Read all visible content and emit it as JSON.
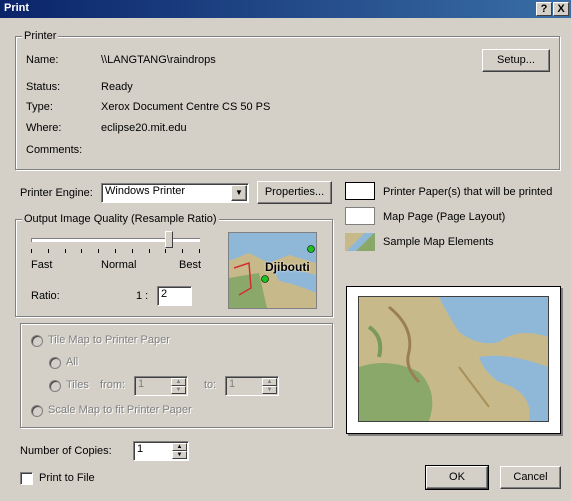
{
  "window": {
    "title": "Print",
    "help_label": "?",
    "close_label": "X"
  },
  "printer": {
    "group_label": "Printer",
    "name_label": "Name:",
    "name_value": "\\\\LANGTANG\\raindrops",
    "status_label": "Status:",
    "status_value": "Ready",
    "type_label": "Type:",
    "type_value": "Xerox Document Centre CS 50 PS",
    "where_label": "Where:",
    "where_value": "eclipse20.mit.edu",
    "comments_label": "Comments:",
    "comments_value": "",
    "setup_button": "Setup..."
  },
  "engine": {
    "label": "Printer Engine:",
    "value": "Windows Printer",
    "properties_button": "Properties..."
  },
  "legend_items": {
    "printer_paper": "Printer Paper(s) that will be printed",
    "map_page": "Map Page (Page Layout)",
    "sample_elements": "Sample Map Elements"
  },
  "quality": {
    "group_label": "Output Image Quality (Resample Ratio)",
    "slider_fraction": 0.82,
    "fast_label": "Fast",
    "normal_label": "Normal",
    "best_label": "Best",
    "ratio_label": "Ratio:",
    "ratio_prefix": "1 :",
    "ratio_value": "2",
    "preview_label": "Djibouti"
  },
  "tiling": {
    "tile_label": "Tile Map to Printer Paper",
    "all_label": "All",
    "tiles_label": "Tiles",
    "from_label": "from:",
    "from_value": "1",
    "to_label": "to:",
    "to_value": "1",
    "scale_label": "Scale Map to fit Printer Paper"
  },
  "copies": {
    "label": "Number of Copies:",
    "value": "1"
  },
  "print_to_file": {
    "label": "Print to File",
    "checked": false
  },
  "buttons": {
    "ok": "OK",
    "cancel": "Cancel"
  },
  "colors": {
    "title_start": "#0a246a",
    "title_end": "#3a6ea5",
    "face": "#d4d0c8",
    "map_water": "#8fb8d8",
    "map_land": "#c8b98a",
    "map_green": "#8aa86a"
  }
}
